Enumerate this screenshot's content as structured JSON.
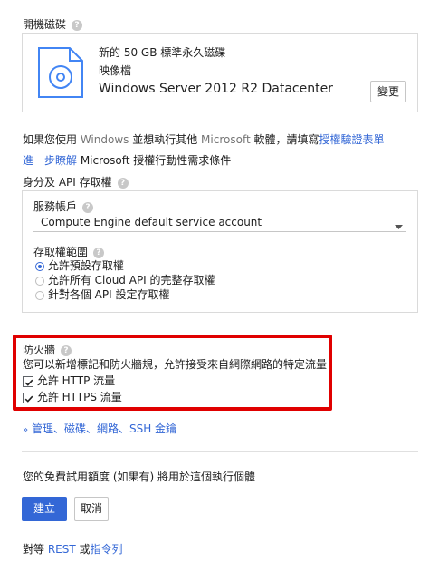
{
  "boot_disk": {
    "label": "開機磁碟",
    "title": "新的 50 GB 標準永久磁碟",
    "subtitle": "映像檔",
    "os": "Windows Server 2012 R2 Datacenter",
    "change_button": "變更"
  },
  "license_note": {
    "prefix": "如果您使用 ",
    "windows": "Windows",
    "middle": " 並想執行其他 ",
    "microsoft": "Microsoft",
    "suffix": " 軟體，請填寫",
    "link": "授權驗證表單"
  },
  "learn_more": {
    "link": "進一步瞭解",
    "text": " Microsoft 授權行動性需求條件"
  },
  "identity": {
    "label": "身分及 API 存取權",
    "service_account_label": "服務帳戶",
    "service_account_value": "Compute Engine default service account",
    "access_scope_label": "存取權範圍",
    "options": [
      "允許預設存取權",
      "允許所有 Cloud API 的完整存取權",
      "針對各個 API 設定存取權"
    ]
  },
  "firewall": {
    "label": "防火牆",
    "description": "您可以新增標記和防火牆規，允許接受來自網際網路的特定流量",
    "http": "允許 HTTP 流量",
    "https": "允許 HTTPS 流量"
  },
  "management_link": "管理、磁碟、網路、SSH 金鑰",
  "free_trial_note": "您的免費試用額度 (如果有) 將用於這個執行個體",
  "create_button": "建立",
  "cancel_button": "取消",
  "equivalent": {
    "prefix": "對等 ",
    "rest": "REST",
    "or": " 或",
    "cli": "指令列"
  },
  "colors": {
    "accent": "#3367d6",
    "highlight": "#e00000"
  }
}
